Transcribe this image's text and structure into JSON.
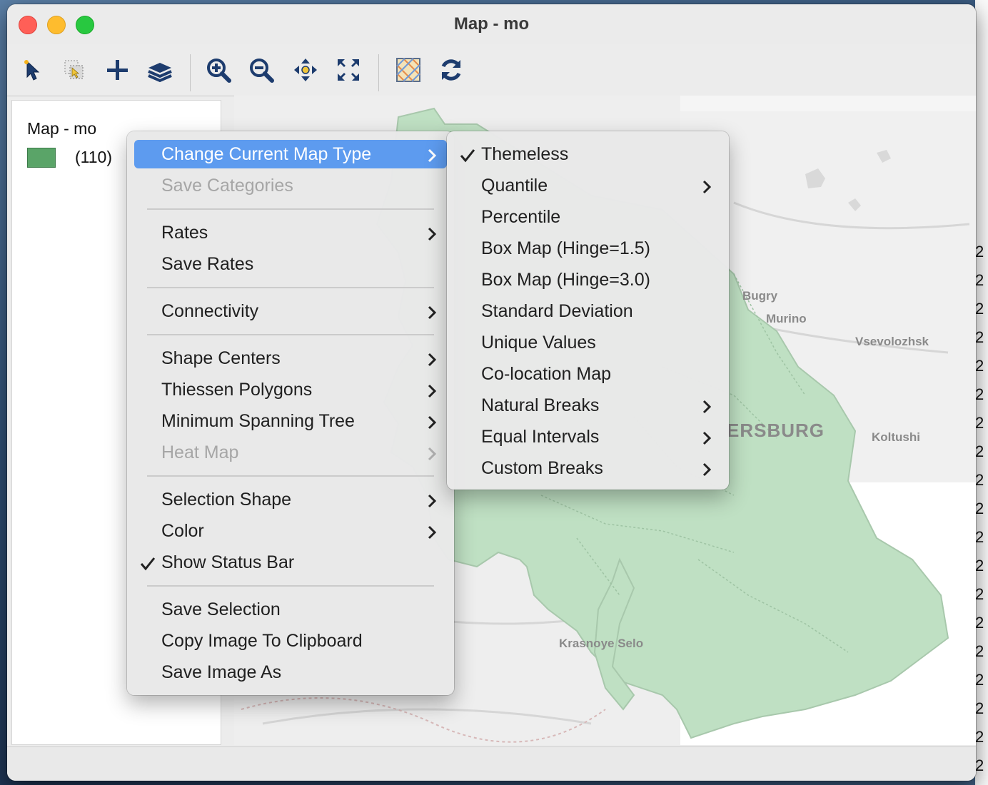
{
  "window": {
    "title": "Map - mo"
  },
  "toolbar": {
    "buttons": [
      "select-tool-icon",
      "select-rectangle-icon",
      "add-layer-icon",
      "layers-icon",
      "zoom-in-icon",
      "zoom-out-icon",
      "pan-icon",
      "full-extent-icon",
      "basemap-icon",
      "refresh-icon"
    ]
  },
  "legend": {
    "title": "Map - mo",
    "items": [
      {
        "label": "(110)",
        "color": "#5aa468"
      }
    ]
  },
  "map": {
    "fill_color": "#bfe0c3",
    "labels": [
      "Bugry",
      "Murino",
      "Vsevolozhsk",
      "ERSBURG",
      "Koltushi",
      "Krasnoye Selo"
    ]
  },
  "context_menu": {
    "items": [
      {
        "label": "Change Current Map Type",
        "submenu": true,
        "highlighted": true
      },
      {
        "label": "Save Categories",
        "disabled": true
      },
      {
        "separator": true
      },
      {
        "label": "Rates",
        "submenu": true
      },
      {
        "label": "Save Rates"
      },
      {
        "separator": true
      },
      {
        "label": "Connectivity",
        "submenu": true
      },
      {
        "separator": true
      },
      {
        "label": "Shape Centers",
        "submenu": true
      },
      {
        "label": "Thiessen Polygons",
        "submenu": true
      },
      {
        "label": "Minimum Spanning Tree",
        "submenu": true
      },
      {
        "label": "Heat Map",
        "submenu": true,
        "disabled": true
      },
      {
        "separator": true
      },
      {
        "label": "Selection Shape",
        "submenu": true
      },
      {
        "label": "Color",
        "submenu": true
      },
      {
        "label": "Show Status Bar",
        "checked": true
      },
      {
        "separator": true
      },
      {
        "label": "Save Selection"
      },
      {
        "label": "Copy Image To Clipboard"
      },
      {
        "label": "Save Image As"
      }
    ]
  },
  "submenu": {
    "items": [
      {
        "label": "Themeless",
        "checked": true
      },
      {
        "label": "Quantile",
        "submenu": true
      },
      {
        "label": "Percentile"
      },
      {
        "label": "Box Map (Hinge=1.5)"
      },
      {
        "label": "Box Map (Hinge=3.0)"
      },
      {
        "label": "Standard Deviation"
      },
      {
        "label": "Unique Values"
      },
      {
        "label": "Co-location Map"
      },
      {
        "label": "Natural Breaks",
        "submenu": true
      },
      {
        "label": "Equal Intervals",
        "submenu": true
      },
      {
        "label": "Custom Breaks",
        "submenu": true
      }
    ]
  }
}
